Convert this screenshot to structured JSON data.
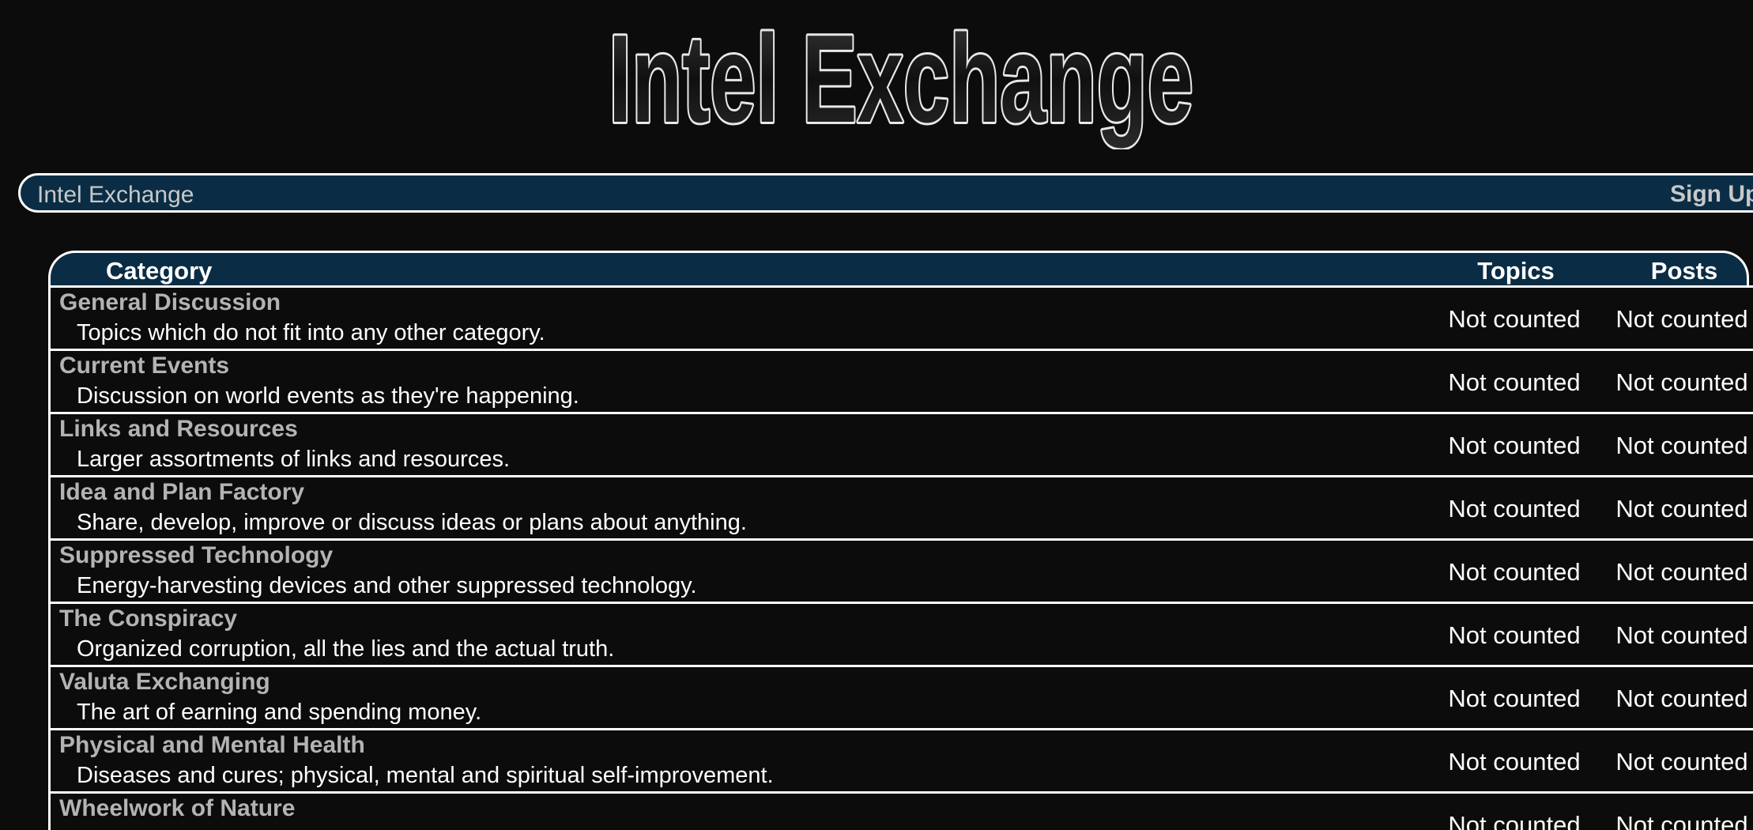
{
  "logo": {
    "text": "Intel Exchange"
  },
  "navbar": {
    "site_title": "Intel Exchange",
    "signup_label": "Sign Up"
  },
  "table": {
    "headers": {
      "category": "Category",
      "topics": "Topics",
      "posts": "Posts"
    },
    "rows": [
      {
        "title": "General Discussion",
        "description": "Topics which do not fit into any other category.",
        "topics": "Not counted",
        "posts": "Not counted"
      },
      {
        "title": "Current Events",
        "description": "Discussion on world events as they're happening.",
        "topics": "Not counted",
        "posts": "Not counted"
      },
      {
        "title": "Links and Resources",
        "description": "Larger assortments of links and resources.",
        "topics": "Not counted",
        "posts": "Not counted"
      },
      {
        "title": "Idea and Plan Factory",
        "description": "Share, develop, improve or discuss ideas or plans about anything.",
        "topics": "Not counted",
        "posts": "Not counted"
      },
      {
        "title": "Suppressed Technology",
        "description": "Energy-harvesting devices and other suppressed technology.",
        "topics": "Not counted",
        "posts": "Not counted"
      },
      {
        "title": "The Conspiracy",
        "description": "Organized corruption, all the lies and the actual truth.",
        "topics": "Not counted",
        "posts": "Not counted"
      },
      {
        "title": "Valuta Exchanging",
        "description": "The art of earning and spending money.",
        "topics": "Not counted",
        "posts": "Not counted"
      },
      {
        "title": "Physical and Mental Health",
        "description": "Diseases and cures; physical, mental and spiritual self-improvement.",
        "topics": "Not counted",
        "posts": "Not counted"
      },
      {
        "title": "Wheelwork of Nature",
        "description": "",
        "topics": "Not counted",
        "posts": "Not counted"
      }
    ]
  },
  "colors": {
    "background": "#0c0c0c",
    "bar_fill": "#0a2d45",
    "border": "#ffffff",
    "link_gray": "#b3b3b3"
  }
}
